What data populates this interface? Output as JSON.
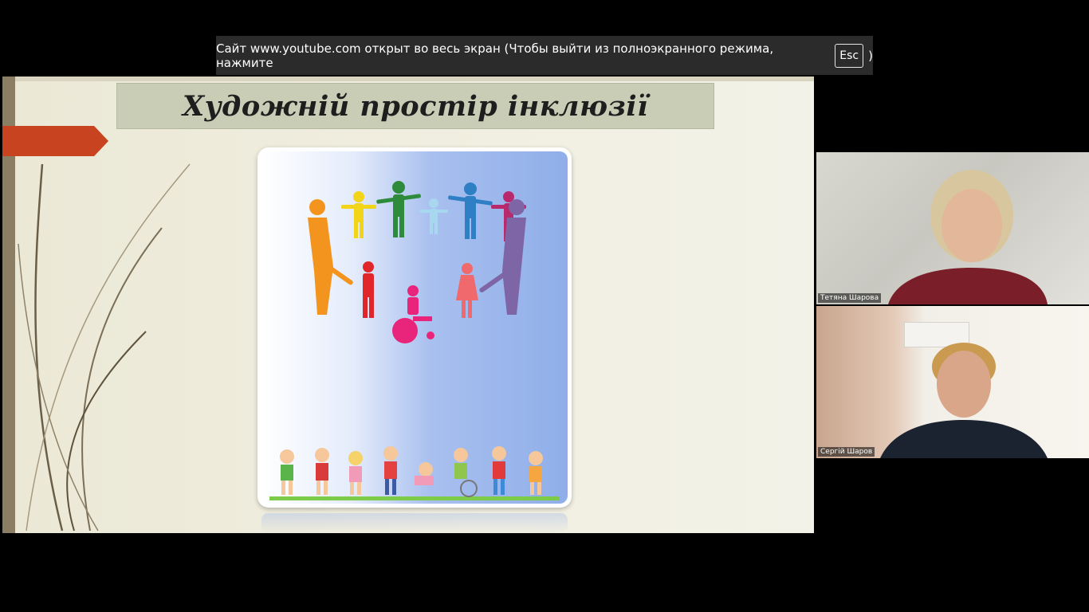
{
  "fullscreen_banner": {
    "text_before": "Сайт www.youtube.com открыт во весь экран (Чтобы выйти из полноэкранного режима, нажмите",
    "key": "Esc",
    "text_after": ")"
  },
  "slide": {
    "title": "Художній простір інклюзії"
  },
  "participants": [
    {
      "name": "Тетяна Шарова"
    },
    {
      "name": "Сергій Шаров"
    }
  ],
  "colors": {
    "banner_bg": "#2b2b2b",
    "title_bar_bg": "#c9cdb5",
    "arrow": "#c8431f",
    "slide_bg": "#efecdd"
  }
}
